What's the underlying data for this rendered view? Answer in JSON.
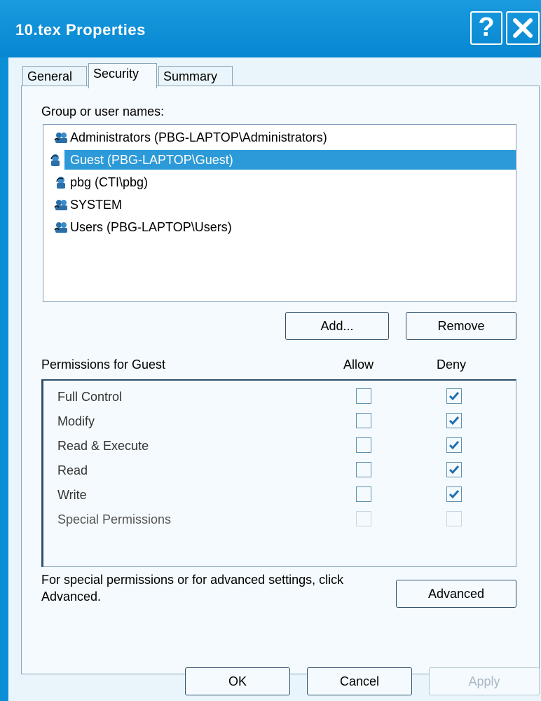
{
  "window": {
    "title": "10.tex Properties",
    "help_label": "?",
    "close_label": "✕"
  },
  "tabs": [
    {
      "label": "General",
      "active": false
    },
    {
      "label": "Security",
      "active": true
    },
    {
      "label": "Summary",
      "active": false
    }
  ],
  "security": {
    "group_label": "Group or user names:",
    "users": [
      {
        "label": "Administrators (PBG-LAPTOP\\Administrators)",
        "icon": "group-icon",
        "selected": false
      },
      {
        "label": "Guest (PBG-LAPTOP\\Guest)",
        "icon": "user-icon",
        "selected": true
      },
      {
        "label": "pbg (CTI\\pbg)",
        "icon": "user-icon",
        "selected": false
      },
      {
        "label": "SYSTEM",
        "icon": "group-icon",
        "selected": false
      },
      {
        "label": "Users (PBG-LAPTOP\\Users)",
        "icon": "group-icon",
        "selected": false
      }
    ],
    "add_label": "Add...",
    "remove_label": "Remove",
    "permissions_for": "Permissions for Guest",
    "allow_header": "Allow",
    "deny_header": "Deny",
    "permissions": [
      {
        "name": "Full Control",
        "allow": false,
        "deny": true,
        "enabled": true
      },
      {
        "name": "Modify",
        "allow": false,
        "deny": true,
        "enabled": true
      },
      {
        "name": "Read & Execute",
        "allow": false,
        "deny": true,
        "enabled": true
      },
      {
        "name": "Read",
        "allow": false,
        "deny": true,
        "enabled": true
      },
      {
        "name": "Write",
        "allow": false,
        "deny": true,
        "enabled": true
      },
      {
        "name": "Special Permissions",
        "allow": false,
        "deny": false,
        "enabled": false
      }
    ],
    "help_text": "For special permissions or for advanced settings, click Advanced.",
    "advanced_label": "Advanced"
  },
  "footer": {
    "ok_label": "OK",
    "cancel_label": "Cancel",
    "apply_label": "Apply",
    "apply_enabled": false
  },
  "colors": {
    "titlebar": "#0686cf",
    "selection": "#2c9ad8",
    "checkmark": "#1f6fb0"
  }
}
